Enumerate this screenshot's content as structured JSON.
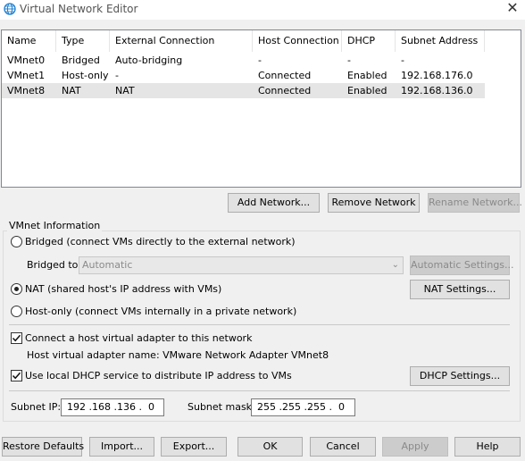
{
  "window": {
    "title": "Virtual Network Editor",
    "close_glyph": "✕",
    "icon": "globe-network-icon"
  },
  "table": {
    "columns": [
      "Name",
      "Type",
      "External Connection",
      "Host Connection",
      "DHCP",
      "Subnet Address"
    ],
    "rows": [
      [
        "VMnet0",
        "Bridged",
        "Auto-bridging",
        "-",
        "-",
        "-"
      ],
      [
        "VMnet1",
        "Host-only",
        "-",
        "Connected",
        "Enabled",
        "192.168.176.0"
      ],
      [
        "VMnet8",
        "NAT",
        "NAT",
        "Connected",
        "Enabled",
        "192.168.136.0"
      ]
    ],
    "selected_row": 2
  },
  "list_buttons": {
    "add": "Add Network...",
    "remove": "Remove Network",
    "rename": "Rename Network..."
  },
  "vmnet_info": {
    "title": "VMnet Information",
    "bridged_label": "Bridged (connect VMs directly to the external network)",
    "bridged_to_label": "Bridged to:",
    "bridged_to_value": "Automatic",
    "automatic_settings": "Automatic Settings...",
    "nat_label": "NAT (shared host's IP address with VMs)",
    "nat_settings": "NAT Settings...",
    "hostonly_label": "Host-only (connect VMs internally in a private network)",
    "selected_mode": "nat",
    "connect_adapter_label": "Connect a host virtual adapter to this network",
    "connect_adapter_checked": true,
    "adapter_name_label": "Host virtual adapter name: VMware Network Adapter VMnet8",
    "dhcp_label": "Use local DHCP service to distribute IP address to VMs",
    "dhcp_checked": true,
    "dhcp_settings": "DHCP Settings...",
    "subnet_ip_label": "Subnet IP:",
    "subnet_ip_value": "192 .168 .136 .  0",
    "subnet_mask_label": "Subnet mask:",
    "subnet_mask_value": "255 .255 .255 .  0"
  },
  "footer": {
    "restore": "Restore Defaults",
    "import": "Import...",
    "export": "Export...",
    "ok": "OK",
    "cancel": "Cancel",
    "apply": "Apply",
    "help": "Help"
  }
}
